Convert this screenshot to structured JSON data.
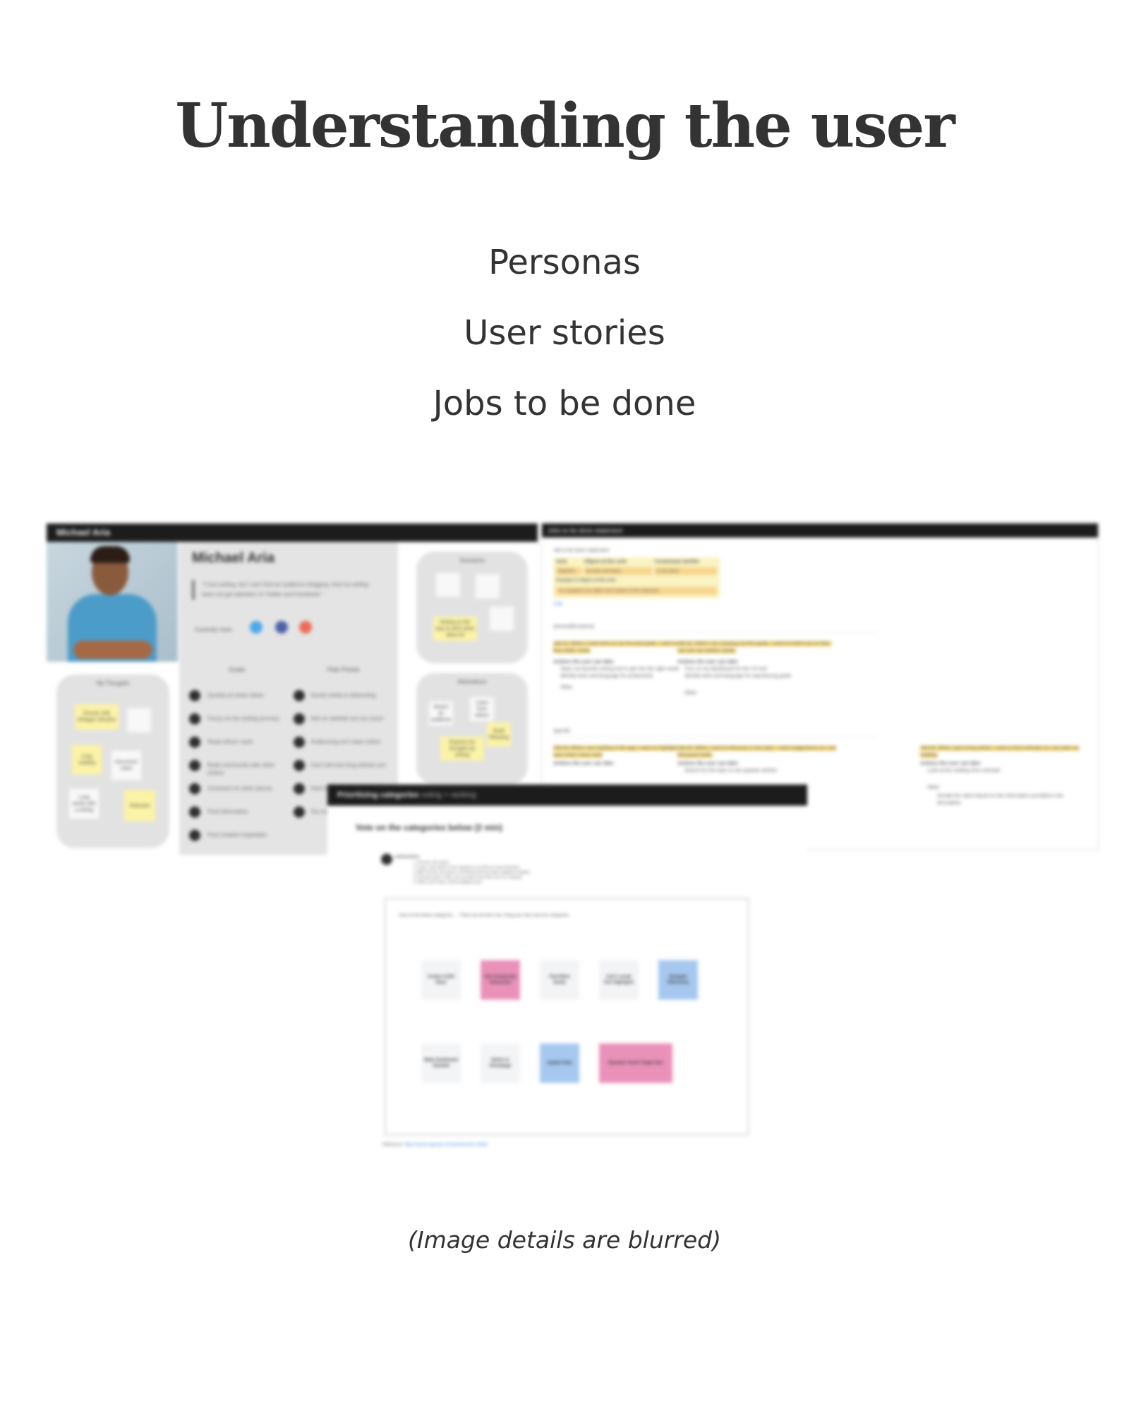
{
  "page": {
    "title": "Understanding the user",
    "topics": [
      "Personas",
      "User stories",
      "Jobs to be done"
    ],
    "caption": "(Image details are blurred)"
  },
  "persona_board": {
    "header": "Michael Aria",
    "name": "Michael Aria",
    "quote": "\"I love writing, but I can't find an audience blogging. And my writing does not get attention on Twitter and Facebook.\"",
    "currently_uses_label": "Currently Uses",
    "social_apps": [
      {
        "name": "Twitter",
        "color": "#4aa8e8"
      },
      {
        "name": "Facebook",
        "color": "#4c62a8"
      },
      {
        "name": "Reddit",
        "color": "#ec6a55"
      }
    ],
    "goals_heading": "Goals",
    "goals": [
      "Quickly jot down ideas",
      "Focus on the writing process",
      "Read others' work",
      "Build community with other writers",
      "Comment on other pieces",
      "Find information",
      "Find creative inspiration"
    ],
    "pain_points_heading": "Pain Points",
    "pain_points": [
      "Social media is distracting",
      "Ads on website are too much",
      "Audiencing isn't clear online",
      "Can't tell how long articles are",
      "Hard to find quality content",
      "Too many platforms"
    ],
    "groups": [
      {
        "title": "My Thoughts",
        "notes": [
          "Chosen with tinkages storyline",
          "",
          "Long reading",
          "Document notes",
          "Long words with a writing",
          "Relevant"
        ]
      },
      {
        "title": "Scenarios",
        "notes": [
          "",
          "",
          "",
          "Writing on the way to work when ideas hit"
        ]
      },
      {
        "title": "Motivations",
        "notes": [
          "Reach an audience",
          "Learn from others",
          "Build following",
          "Express his thoughts by writing"
        ]
      }
    ]
  },
  "jtbd_doc": {
    "header": "Jobs to be done statement",
    "intro": "Job to be done statement",
    "table_headers": [
      "Verb",
      "Object of the verb",
      "Contextual clarifier"
    ],
    "table_row": [
      "Organize",
      "my work and ideas",
      "in one place"
    ],
    "example_label": "Example in Object of the verb",
    "example_text": "An example of an object and context of the statement",
    "link": "Link",
    "section_general": "General/Emotional",
    "section_specific": "Specific",
    "general_jobs": [
      {
        "text": "Job #1: When I read work on my focused goals, I want to focus so I feel in flow while I write.",
        "how_label": "Actions the user can take:",
        "bullets": [
          "Open my favorite writing tool to get into the right mode",
          "Identify tools and language for productivity",
          "Other"
        ]
      },
      {
        "text": "Job #2: When I am creating my first goals, I want to build trust so that I can see my readers' goals.",
        "how_label": "Actions the user can take:",
        "bullets": [
          "Turn on my dashboard for the UX tool",
          "Identify tools and language for reproducing goals",
          "Other"
        ]
      }
    ],
    "specific_jobs": [
      {
        "text": "Job #3: When I am reading in the app, I want to highlight text so I can save what I have read.",
        "how_label": "Actions the user can take:",
        "bullets": [
          "Highlight text and add notes"
        ]
      },
      {
        "text": "Job #4: When I want to discover a new topic, I want suggestions so I can find good reads.",
        "how_label": "Actions the user can take:",
        "bullets": [
          "Search for the topic to see popular articles"
        ]
      },
      {
        "text": "Job #5: When I get a long article, I want a time estimate so I can plan my reading.",
        "how_label": "Actions the user can take:",
        "bullets": [
          "Look at the reading time estimate",
          "Other",
          "Decide the value based on the information provided in the description"
        ]
      }
    ]
  },
  "prioritizing": {
    "header": "Prioritizing categories",
    "header_sub": "voting + ranking",
    "title": "Vote on the categories below (2 min)",
    "instructions_label": "Instructions",
    "instructions": [
      "1. Find the vote sticker",
      "2. Drag a vote sticker to the categories you think are most important",
      "3. After all votes are placed, we'll discuss the top-voted categories together",
      "4. Everyone gets 3 votes; you can place more than one on a category",
      "5. When you're done, let the facilitator know"
    ],
    "board_heading": "Vote on the below categories  →  There are all here now. Drag your dots onto the categories",
    "cards_row1": [
      {
        "label": "Create & Edit Ideas",
        "color": "#f3f4f6"
      },
      {
        "label": "Get Community Interaction",
        "color": "#e991b9"
      },
      {
        "label": "Find Work Easily",
        "color": "#f3f4f6"
      },
      {
        "label": "Can't Locate Text Highlights",
        "color": "#f3f4f6"
      },
      {
        "label": "Navigate Effectively",
        "color": "#a6c8ef"
      }
    ],
    "cards_row2": [
      {
        "label": "Make Dashboard Valuable",
        "color": "#f3f4f6"
      },
      {
        "label": "Notice in Homepage",
        "color": "#f3f4f6"
      },
      {
        "label": "Update Data",
        "color": "#a6c8ef"
      },
      {
        "label": "Dynamic Touch Target Size",
        "color": "#e991b9"
      }
    ],
    "reference_label": "Reference:",
    "reference_link": "https://www.nngroup.com/articles/dot-voting/"
  }
}
